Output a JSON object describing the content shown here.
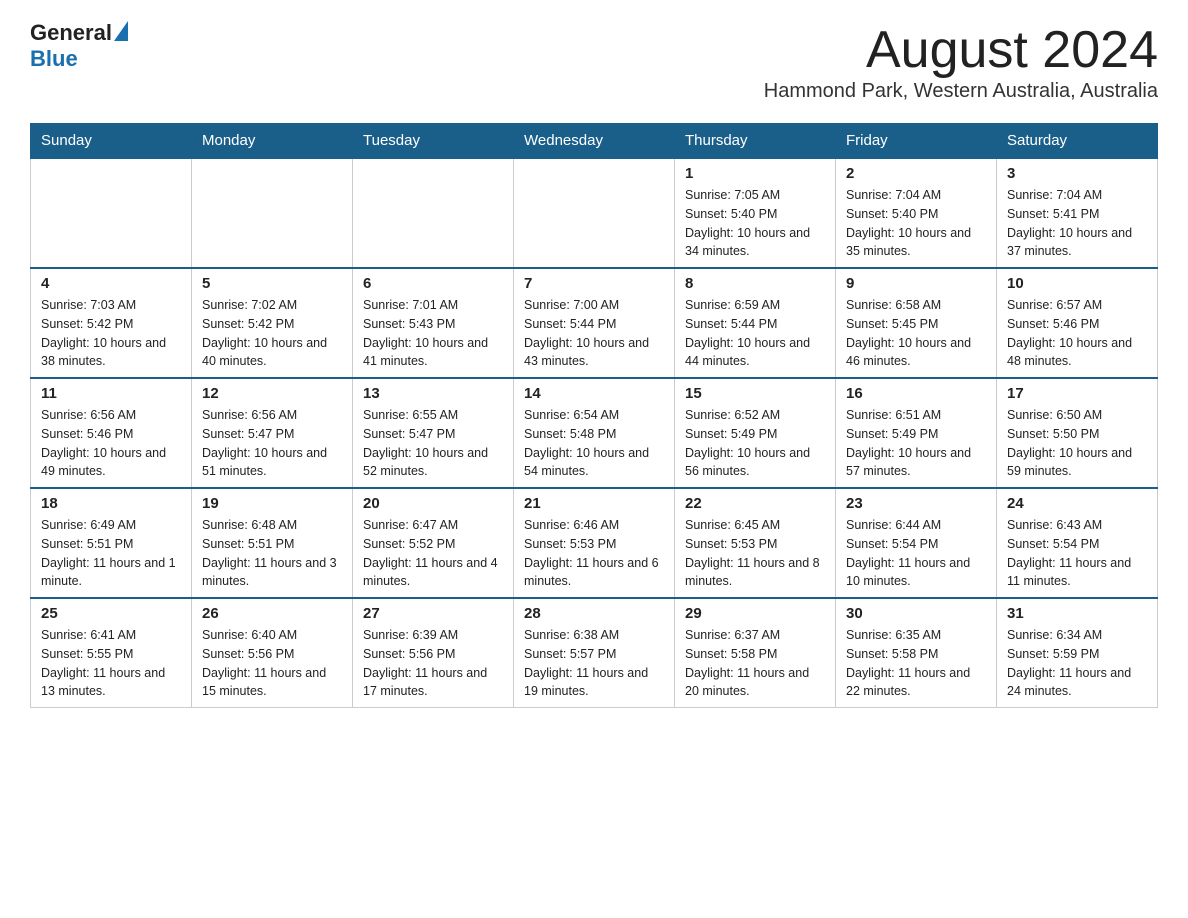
{
  "header": {
    "logo_general": "General",
    "logo_blue": "Blue",
    "month_title": "August 2024",
    "location": "Hammond Park, Western Australia, Australia"
  },
  "days_of_week": [
    "Sunday",
    "Monday",
    "Tuesday",
    "Wednesday",
    "Thursday",
    "Friday",
    "Saturday"
  ],
  "weeks": [
    [
      {
        "day": "",
        "info": ""
      },
      {
        "day": "",
        "info": ""
      },
      {
        "day": "",
        "info": ""
      },
      {
        "day": "",
        "info": ""
      },
      {
        "day": "1",
        "info": "Sunrise: 7:05 AM\nSunset: 5:40 PM\nDaylight: 10 hours and 34 minutes."
      },
      {
        "day": "2",
        "info": "Sunrise: 7:04 AM\nSunset: 5:40 PM\nDaylight: 10 hours and 35 minutes."
      },
      {
        "day": "3",
        "info": "Sunrise: 7:04 AM\nSunset: 5:41 PM\nDaylight: 10 hours and 37 minutes."
      }
    ],
    [
      {
        "day": "4",
        "info": "Sunrise: 7:03 AM\nSunset: 5:42 PM\nDaylight: 10 hours and 38 minutes."
      },
      {
        "day": "5",
        "info": "Sunrise: 7:02 AM\nSunset: 5:42 PM\nDaylight: 10 hours and 40 minutes."
      },
      {
        "day": "6",
        "info": "Sunrise: 7:01 AM\nSunset: 5:43 PM\nDaylight: 10 hours and 41 minutes."
      },
      {
        "day": "7",
        "info": "Sunrise: 7:00 AM\nSunset: 5:44 PM\nDaylight: 10 hours and 43 minutes."
      },
      {
        "day": "8",
        "info": "Sunrise: 6:59 AM\nSunset: 5:44 PM\nDaylight: 10 hours and 44 minutes."
      },
      {
        "day": "9",
        "info": "Sunrise: 6:58 AM\nSunset: 5:45 PM\nDaylight: 10 hours and 46 minutes."
      },
      {
        "day": "10",
        "info": "Sunrise: 6:57 AM\nSunset: 5:46 PM\nDaylight: 10 hours and 48 minutes."
      }
    ],
    [
      {
        "day": "11",
        "info": "Sunrise: 6:56 AM\nSunset: 5:46 PM\nDaylight: 10 hours and 49 minutes."
      },
      {
        "day": "12",
        "info": "Sunrise: 6:56 AM\nSunset: 5:47 PM\nDaylight: 10 hours and 51 minutes."
      },
      {
        "day": "13",
        "info": "Sunrise: 6:55 AM\nSunset: 5:47 PM\nDaylight: 10 hours and 52 minutes."
      },
      {
        "day": "14",
        "info": "Sunrise: 6:54 AM\nSunset: 5:48 PM\nDaylight: 10 hours and 54 minutes."
      },
      {
        "day": "15",
        "info": "Sunrise: 6:52 AM\nSunset: 5:49 PM\nDaylight: 10 hours and 56 minutes."
      },
      {
        "day": "16",
        "info": "Sunrise: 6:51 AM\nSunset: 5:49 PM\nDaylight: 10 hours and 57 minutes."
      },
      {
        "day": "17",
        "info": "Sunrise: 6:50 AM\nSunset: 5:50 PM\nDaylight: 10 hours and 59 minutes."
      }
    ],
    [
      {
        "day": "18",
        "info": "Sunrise: 6:49 AM\nSunset: 5:51 PM\nDaylight: 11 hours and 1 minute."
      },
      {
        "day": "19",
        "info": "Sunrise: 6:48 AM\nSunset: 5:51 PM\nDaylight: 11 hours and 3 minutes."
      },
      {
        "day": "20",
        "info": "Sunrise: 6:47 AM\nSunset: 5:52 PM\nDaylight: 11 hours and 4 minutes."
      },
      {
        "day": "21",
        "info": "Sunrise: 6:46 AM\nSunset: 5:53 PM\nDaylight: 11 hours and 6 minutes."
      },
      {
        "day": "22",
        "info": "Sunrise: 6:45 AM\nSunset: 5:53 PM\nDaylight: 11 hours and 8 minutes."
      },
      {
        "day": "23",
        "info": "Sunrise: 6:44 AM\nSunset: 5:54 PM\nDaylight: 11 hours and 10 minutes."
      },
      {
        "day": "24",
        "info": "Sunrise: 6:43 AM\nSunset: 5:54 PM\nDaylight: 11 hours and 11 minutes."
      }
    ],
    [
      {
        "day": "25",
        "info": "Sunrise: 6:41 AM\nSunset: 5:55 PM\nDaylight: 11 hours and 13 minutes."
      },
      {
        "day": "26",
        "info": "Sunrise: 6:40 AM\nSunset: 5:56 PM\nDaylight: 11 hours and 15 minutes."
      },
      {
        "day": "27",
        "info": "Sunrise: 6:39 AM\nSunset: 5:56 PM\nDaylight: 11 hours and 17 minutes."
      },
      {
        "day": "28",
        "info": "Sunrise: 6:38 AM\nSunset: 5:57 PM\nDaylight: 11 hours and 19 minutes."
      },
      {
        "day": "29",
        "info": "Sunrise: 6:37 AM\nSunset: 5:58 PM\nDaylight: 11 hours and 20 minutes."
      },
      {
        "day": "30",
        "info": "Sunrise: 6:35 AM\nSunset: 5:58 PM\nDaylight: 11 hours and 22 minutes."
      },
      {
        "day": "31",
        "info": "Sunrise: 6:34 AM\nSunset: 5:59 PM\nDaylight: 11 hours and 24 minutes."
      }
    ]
  ]
}
